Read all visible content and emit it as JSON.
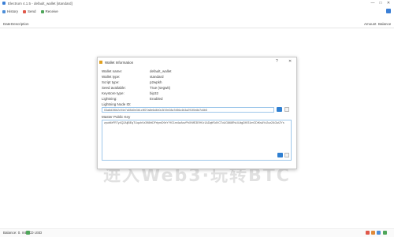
{
  "app": {
    "title": "Electrum 4.1.5 - default_wallet [standard]"
  },
  "window_controls": {
    "minimize": "—",
    "maximize": "□",
    "close": "✕"
  },
  "toolbar": {
    "items": [
      {
        "label": "History",
        "icon": "history-icon"
      },
      {
        "label": "Send",
        "icon": "send-icon"
      },
      {
        "label": "Receive",
        "icon": "receive-icon"
      }
    ]
  },
  "list": {
    "col_date": "Date",
    "col_description": "Description",
    "col_amount": "Amount",
    "col_balance": "Balance"
  },
  "dialog": {
    "title": "Wallet Information",
    "help": "?",
    "close": "✕",
    "rows": [
      {
        "key": "Wallet name:",
        "value": "default_wallet"
      },
      {
        "key": "Wallet type:",
        "value": "standard"
      },
      {
        "key": "Script type:",
        "value": "p2wpkh"
      },
      {
        "key": "Seed available:",
        "value": "True (segwit)"
      },
      {
        "key": "Keystore type:",
        "value": "bip32"
      },
      {
        "key": "Lightning:",
        "value": "Enabled"
      }
    ],
    "lightning_id_label": "Lightning Node ID:",
    "lightning_id_value": "03a8d1f6b2c94e7a55d0e3b1c9f27a8e6d4b0c3f19e28a7d56c4b3a291f0e8d7c6b5",
    "mpk_label": "Master Public Key",
    "mpk_value": "zpub6rFR7y4Q2AijBEqTUquhVz398htDFrtymD9xYYfG1m4wAcvPhXNfE3EfH1r1ADqtfSdVCToUG868RvUUkgDKf31mGDtKsAYz2oz2AGutZYs"
  },
  "watermark": "进入Web3·玩转BTC",
  "status": {
    "balance": "Balance: 0. mBTC",
    "fiat": "0 USD",
    "connected_icon": "network-icon"
  },
  "colors": {
    "accent": "#2f7fd1",
    "field_border": "#9ec7ea",
    "dialog_icon": "#e0a020"
  }
}
